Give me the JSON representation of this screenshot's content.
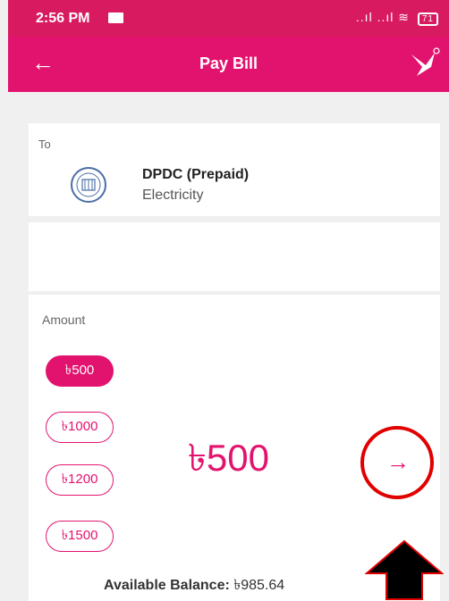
{
  "status_bar": {
    "time": "2:56 PM",
    "signal": "..ıl ..ıl",
    "battery": "71"
  },
  "app_bar": {
    "title": "Pay Bill"
  },
  "to_section": {
    "label": "To",
    "biller_name": "DPDC (Prepaid)",
    "biller_type": "Electricity"
  },
  "amount_section": {
    "label": "Amount",
    "options": [
      "৳500",
      "৳1000",
      "৳1200",
      "৳1500"
    ],
    "selected": "৳500",
    "display_amount": "৳500",
    "next_icon": "arrow-right"
  },
  "balance": {
    "label": "Available Balance:",
    "value": "৳985.64"
  },
  "colors": {
    "brand": "#e2136e",
    "annotation": "#e00000"
  }
}
